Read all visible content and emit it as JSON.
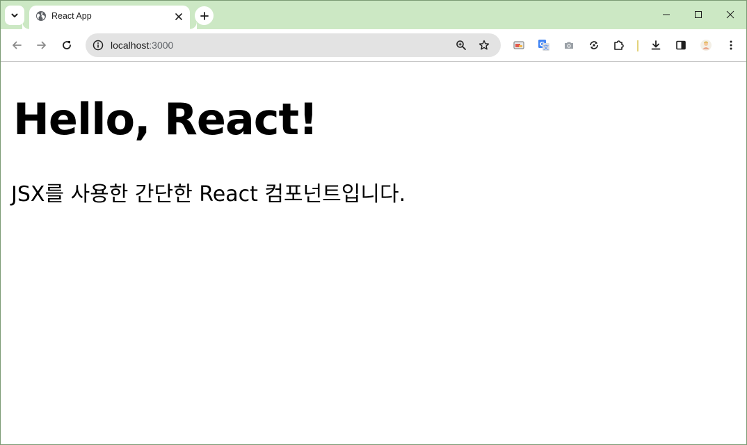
{
  "browser": {
    "tab": {
      "title": "React App"
    },
    "address_bar": {
      "host": "localhost",
      "port": ":3000"
    },
    "icons": {
      "tab_search": "chevron-down-icon",
      "favicon": "globe-icon",
      "close_tab": "close-icon",
      "new_tab": "plus-icon",
      "back": "arrow-left-icon",
      "forward": "arrow-right-icon",
      "reload": "reload-icon",
      "site_info": "info-icon",
      "zoom": "zoom-in-icon",
      "bookmark": "star-icon",
      "cast": "cast-icon",
      "translate": "translate-icon",
      "screenshot": "camera-icon",
      "sync": "sync-icon",
      "extensions": "puzzle-icon",
      "downloads": "download-icon",
      "side_panel": "side-panel-icon",
      "profile": "avatar-icon",
      "menu": "kebab-menu-icon"
    },
    "colors": {
      "frame": "#cce8c4",
      "omnibox": "#e3e3e3",
      "translate_blue": "#4285f4"
    }
  },
  "page": {
    "heading": "Hello, React!",
    "paragraph": "JSX를 사용한 간단한 React 컴포넌트입니다."
  }
}
